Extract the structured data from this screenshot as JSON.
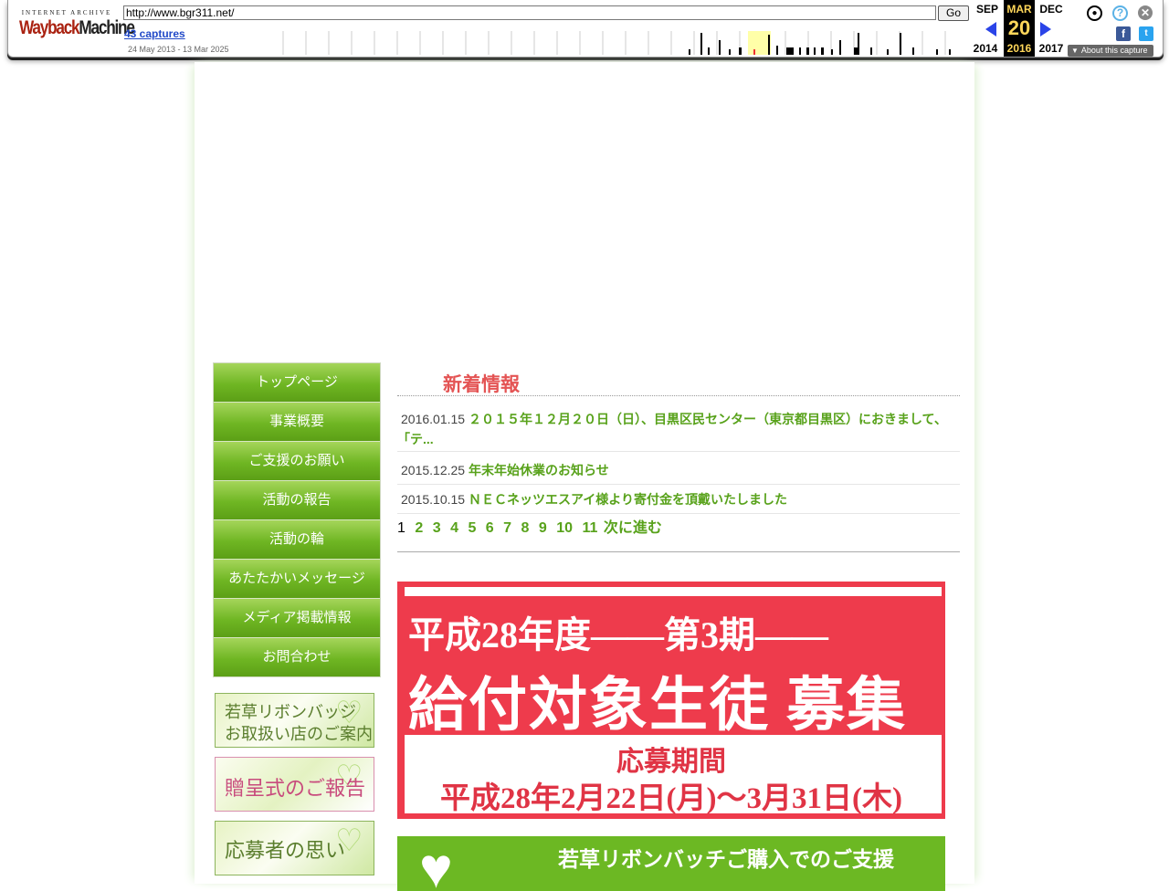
{
  "wayback": {
    "logo_top": "INTERNET ARCHIVE",
    "logo_main_a": "Wayback",
    "logo_main_b": "Machine",
    "url": "http://www.bgr311.net/",
    "go_label": "Go",
    "captures_link": "43 captures",
    "capture_range": "24 May 2013 - 13 Mar 2025",
    "prev_month": "SEP",
    "prev_year": "2014",
    "cur_month": "MAR",
    "cur_day": "20",
    "cur_year": "2016",
    "next_month": "DEC",
    "next_year": "2017",
    "about_label": "About this capture",
    "icons": [
      "user-icon",
      "help-icon",
      "close-icon",
      "facebook-icon",
      "twitter-icon"
    ],
    "accent": "#ffd75a"
  },
  "nav": {
    "items": [
      {
        "label": "トップページ"
      },
      {
        "label": "事業概要"
      },
      {
        "label": "ご支援のお願い"
      },
      {
        "label": "活動の報告"
      },
      {
        "label": "活動の輪"
      },
      {
        "label": "あたたかいメッセージ"
      },
      {
        "label": "メディア掲載情報"
      },
      {
        "label": "お問合わせ"
      }
    ]
  },
  "side_banners": [
    {
      "text_line1": "若草リボンバッジ",
      "text_line2": "お取扱い店のご案内"
    },
    {
      "text": "贈呈式のご報告"
    },
    {
      "text": "応募者の思い"
    }
  ],
  "news": {
    "title": "新着情報",
    "items": [
      {
        "date": "2016.01.15",
        "text": "２０１５年１２月２０日（日）、目黒区民センター（東京都目黒区）におきまして、「テ..."
      },
      {
        "date": "2015.12.25",
        "text": "年末年始休業のお知らせ"
      },
      {
        "date": "2015.10.15",
        "text": "ＮＥＣネッツエスアイ様より寄付金を頂戴いたしました"
      }
    ],
    "pager": {
      "current": "1",
      "pages": [
        "2",
        "3",
        "4",
        "5",
        "6",
        "7",
        "8",
        "9",
        "10",
        "11"
      ],
      "next_label": "次に進む"
    }
  },
  "recruit_banner": {
    "line1": "平成28年度――第3期――",
    "line2": "給付対象生徒 募集",
    "line3": "応募期間",
    "line4": "平成28年2月22日(月)～3月31日(木)"
  },
  "ribbon_banner": {
    "text": "若草リボンバッチご購入でのご支援"
  }
}
